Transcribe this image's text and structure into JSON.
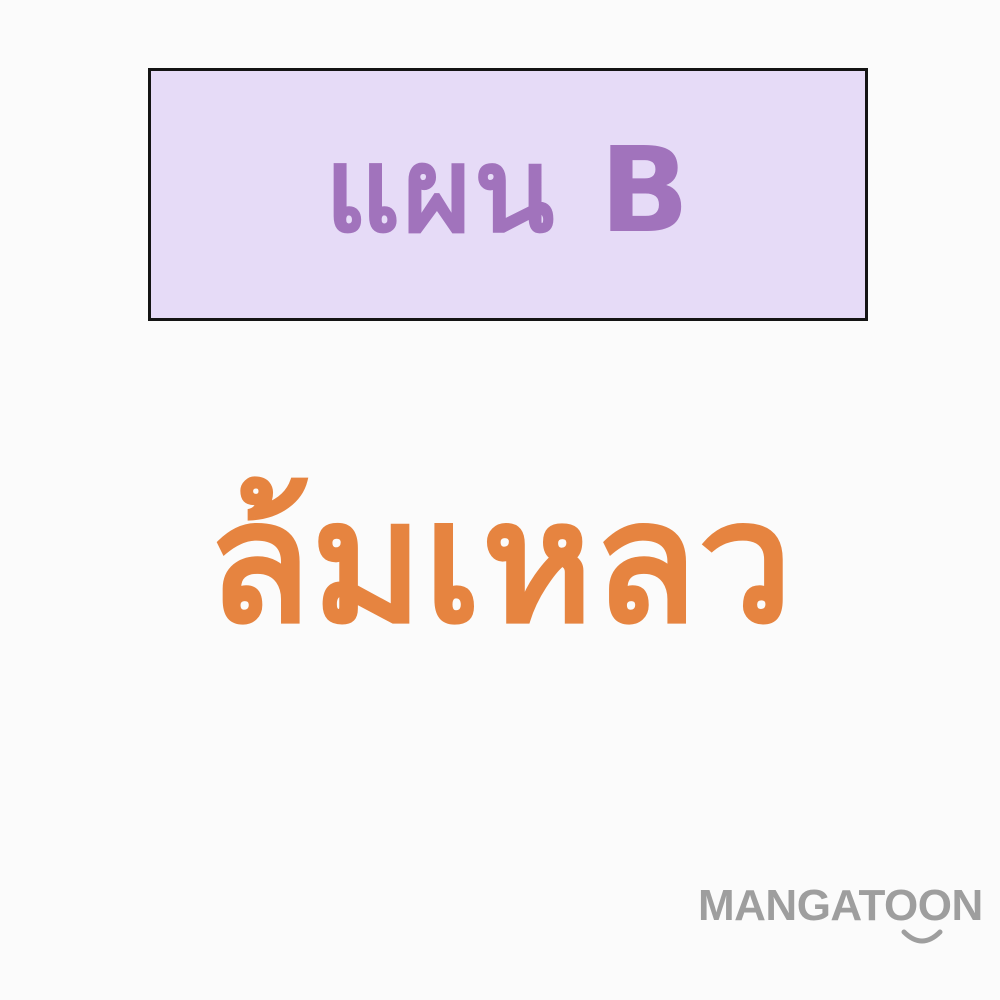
{
  "panel": {
    "title_box": {
      "text": "แผน B"
    },
    "caption": {
      "text": "ล้มเหลว"
    },
    "watermark": {
      "text": "MANGATOON",
      "icon": "smile-icon"
    }
  },
  "colors": {
    "background": "#fbfbfb",
    "title_box_fill": "#e6dbf7",
    "title_box_border": "#141414",
    "title_text": "#a173bc",
    "caption_text": "#e68440",
    "watermark": "#9e9e9e"
  }
}
